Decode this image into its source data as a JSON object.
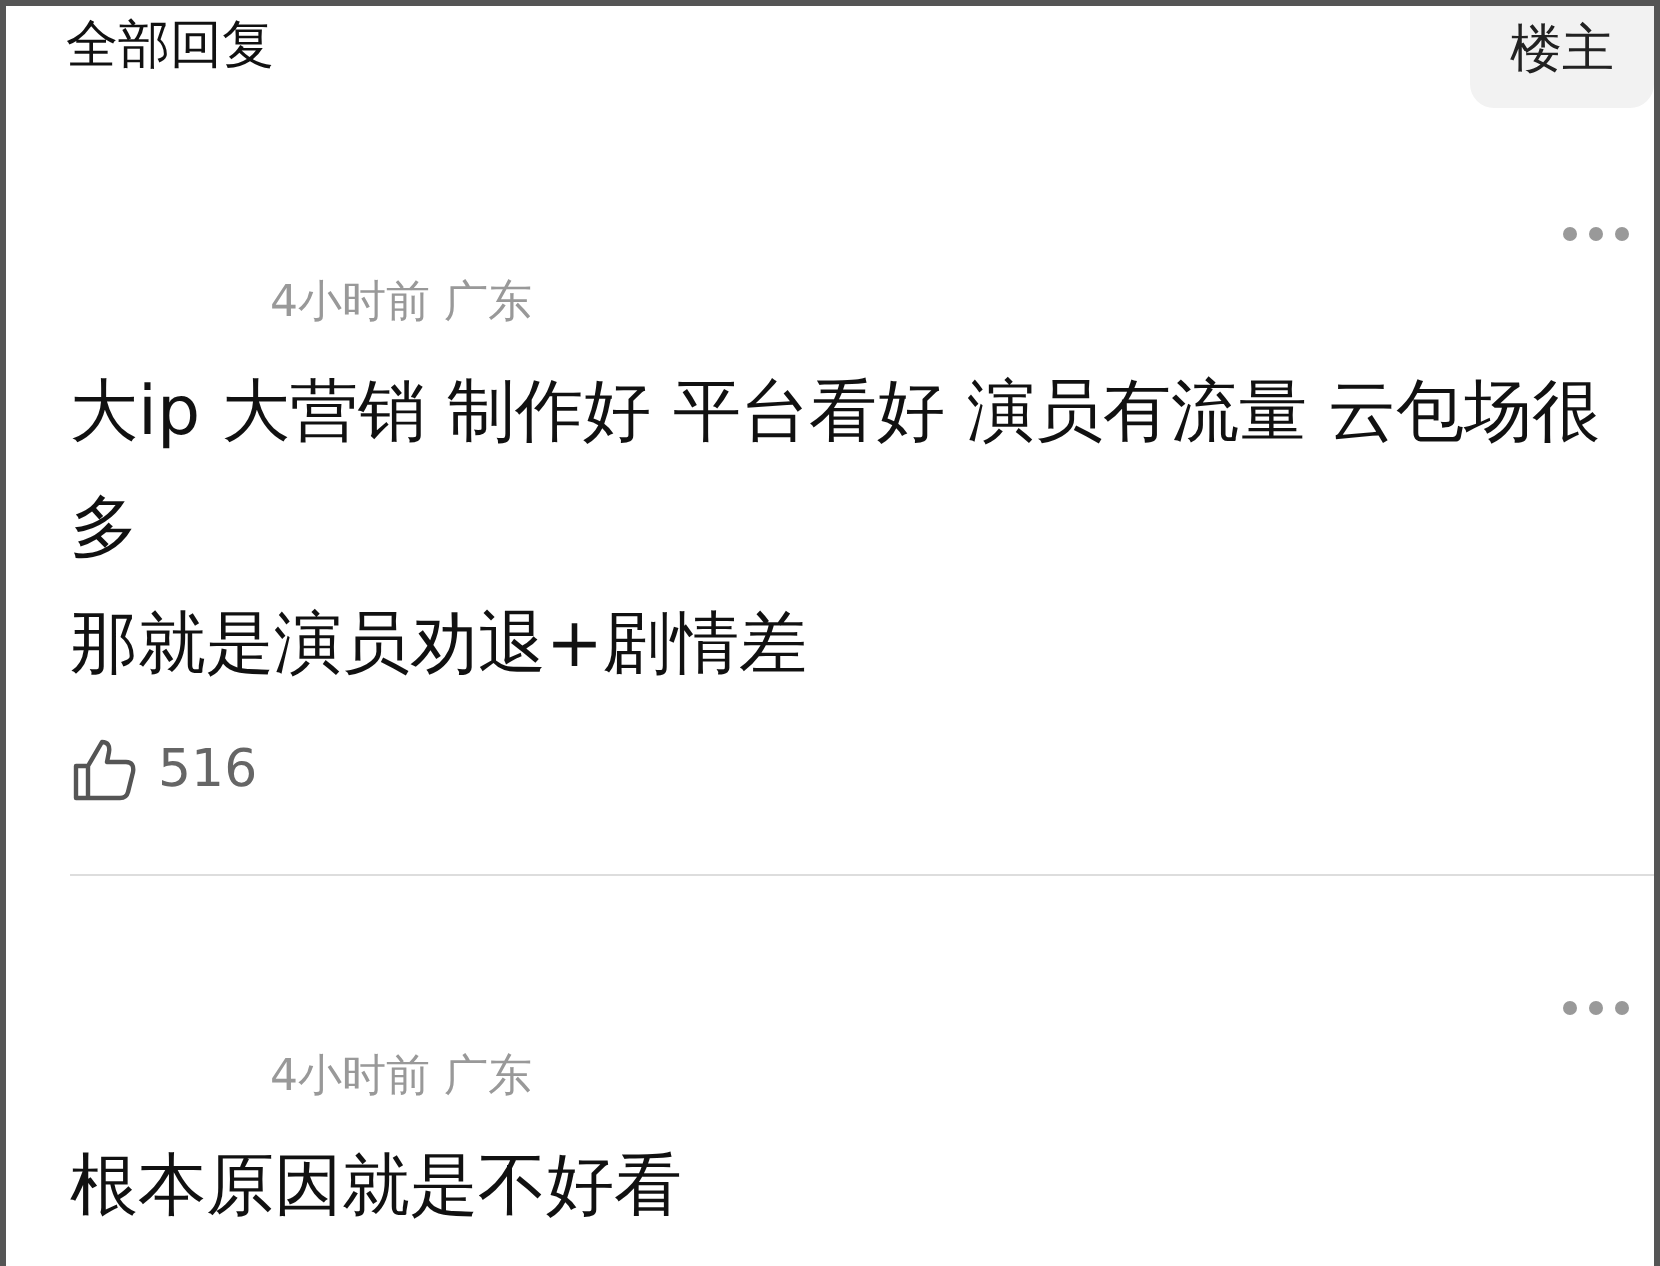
{
  "header": {
    "title": "全部回复",
    "filter_button": "楼主"
  },
  "comments": [
    {
      "meta": "4小时前 广东",
      "lines": [
        "大ip 大营销 制作好 平台看好 演员有流量 云包场很多",
        "那就是演员劝退+剧情差"
      ],
      "likes": "516"
    },
    {
      "meta": "4小时前 广东",
      "lines": [
        "根本原因就是不好看"
      ]
    }
  ]
}
